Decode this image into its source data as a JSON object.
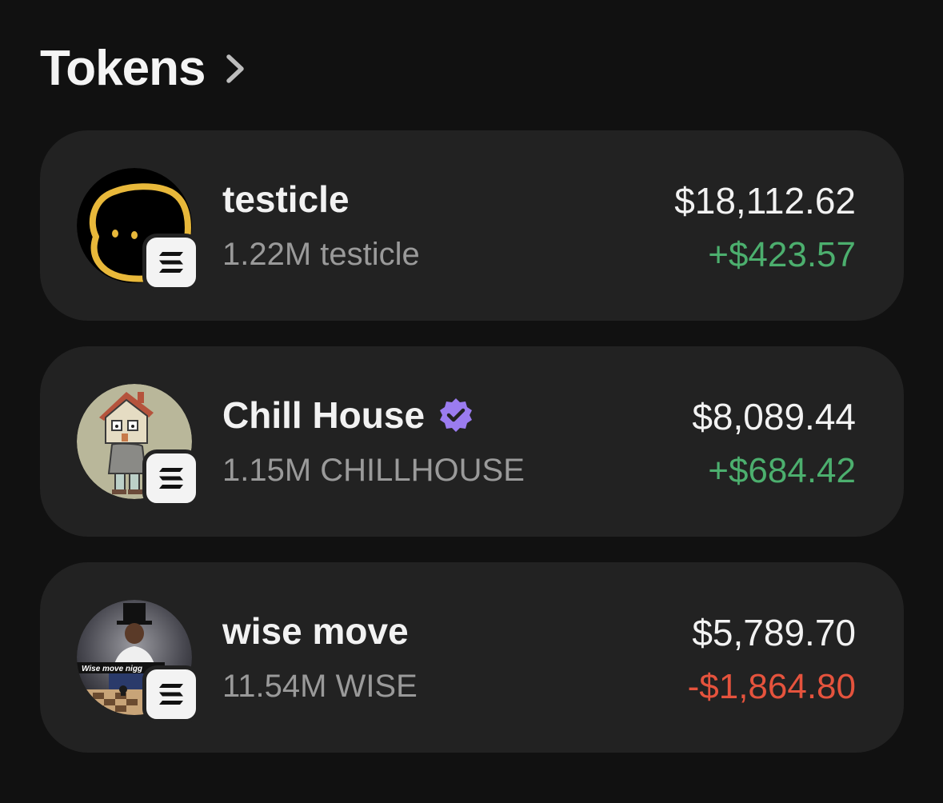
{
  "header": {
    "title": "Tokens",
    "chevron_icon": "chevron-right-icon"
  },
  "colors": {
    "background": "#111111",
    "card": "#222222",
    "positive": "#4caf6e",
    "negative": "#e5533d",
    "verified": "#9b7cf0",
    "secondary_text": "#9a9a9a"
  },
  "tokens": [
    {
      "name": "testicle",
      "verified": false,
      "balance": "1.22M testicle",
      "value": "$18,112.62",
      "change": "+$423.57",
      "change_direction": "positive",
      "avatar_icon": "testicle-token-avatar",
      "chain_icon": "solana-icon"
    },
    {
      "name": "Chill House",
      "verified": true,
      "balance": "1.15M CHILLHOUSE",
      "value": "$8,089.44",
      "change": "+$684.42",
      "change_direction": "positive",
      "avatar_icon": "chill-house-token-avatar",
      "chain_icon": "solana-icon"
    },
    {
      "name": "wise move",
      "verified": false,
      "balance": "11.54M WISE",
      "value": "$5,789.70",
      "change": "-$1,864.80",
      "change_direction": "negative",
      "avatar_icon": "wise-move-token-avatar",
      "chain_icon": "solana-icon"
    }
  ]
}
